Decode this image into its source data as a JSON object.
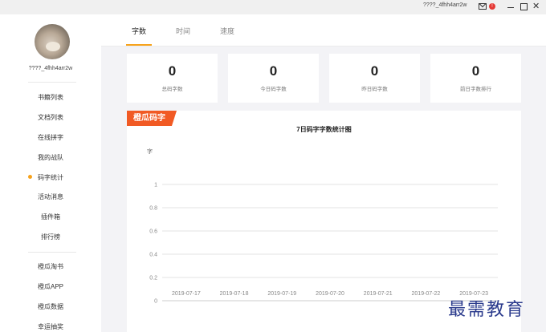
{
  "titlebar": {
    "username": "????_4fhh4arr2w",
    "icons": [
      "mail-icon",
      "notification-dot",
      "minimize-icon",
      "maximize-icon",
      "close-icon"
    ],
    "notification_mark": "!"
  },
  "sidebar": {
    "username": "????_4fhh4arr2w",
    "nav_primary": [
      {
        "label": "书籍列表"
      },
      {
        "label": "文档列表"
      },
      {
        "label": "在线拼字"
      },
      {
        "label": "我的战队"
      },
      {
        "label": "码字统计",
        "active": true
      },
      {
        "label": "活动消息"
      },
      {
        "label": "插件箱"
      },
      {
        "label": "排行榜"
      }
    ],
    "nav_secondary": [
      {
        "label": "橙瓜淘书"
      },
      {
        "label": "橙瓜APP"
      },
      {
        "label": "橙瓜数据"
      },
      {
        "label": "幸运抽奖"
      }
    ]
  },
  "tabs": [
    {
      "label": "字数",
      "active": true
    },
    {
      "label": "时间"
    },
    {
      "label": "速度"
    }
  ],
  "stats": [
    {
      "value": "0",
      "label": "总码字数"
    },
    {
      "value": "0",
      "label": "今日码字数"
    },
    {
      "value": "0",
      "label": "昨日码字数"
    },
    {
      "value": "0",
      "label": "前日字数排行"
    }
  ],
  "badge": "橙瓜码字",
  "chart_data": {
    "type": "line",
    "title": "7日码字字数统计图",
    "ylabel": "字",
    "xlabel": "",
    "categories": [
      "2019-07-17",
      "2019-07-18",
      "2019-07-19",
      "2019-07-20",
      "2019-07-21",
      "2019-07-22",
      "2019-07-23"
    ],
    "y_ticks": [
      "0",
      "0.2",
      "0.4",
      "0.6",
      "0.8",
      "1"
    ],
    "ylim": [
      0,
      1
    ],
    "grid": true,
    "legend": "none",
    "colors": {
      "grid": "#e3e3e3",
      "axis": "#cccccc",
      "tick_text": "#888888"
    }
  },
  "watermark": "最需教育",
  "colors": {
    "accent": "#f7a21b",
    "badge": "#f15a24",
    "watermark": "#2a3a8c"
  }
}
